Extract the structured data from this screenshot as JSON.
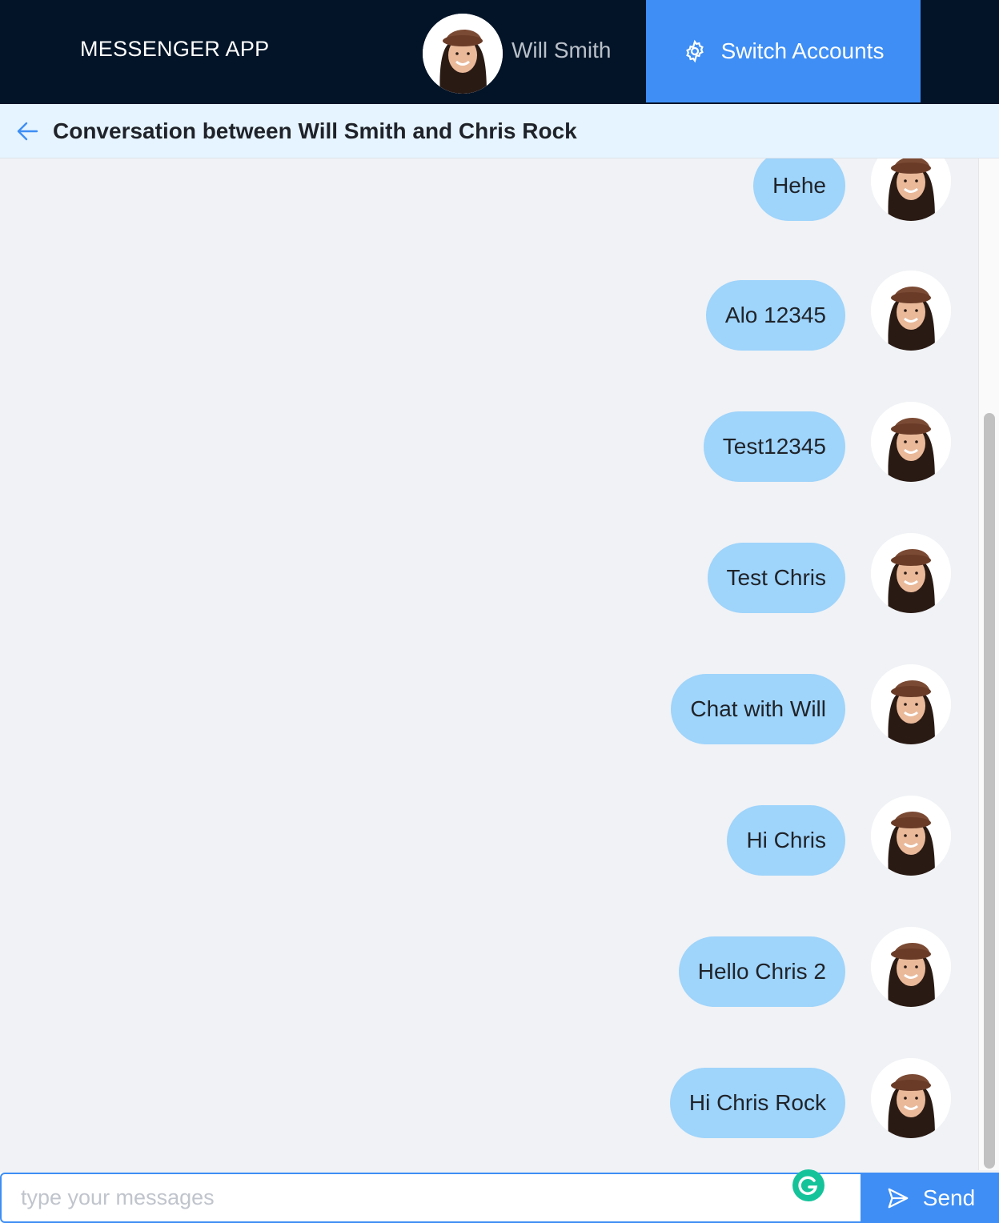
{
  "header": {
    "app_title": "MESSENGER APP",
    "user_name": "Will Smith",
    "switch_label": "Switch Accounts",
    "switch_icon": "gear-icon",
    "accent_color": "#3e8ef5",
    "bg_color": "#031428"
  },
  "conversation": {
    "title": "Conversation between Will Smith and Chris Rock",
    "back_icon": "arrow-left-icon"
  },
  "messages": [
    {
      "text": "Hehe"
    },
    {
      "text": "Alo 12345"
    },
    {
      "text": "Test12345"
    },
    {
      "text": "Test Chris"
    },
    {
      "text": "Chat with Will"
    },
    {
      "text": "Hi Chris"
    },
    {
      "text": "Hello Chris 2"
    },
    {
      "text": "Hi Chris Rock"
    }
  ],
  "composer": {
    "placeholder": "type your messages",
    "value": "",
    "send_label": "Send",
    "send_icon": "send-icon"
  },
  "colors": {
    "bubble": "#9fd4fb",
    "conv_header_bg": "#e6f4ff"
  }
}
